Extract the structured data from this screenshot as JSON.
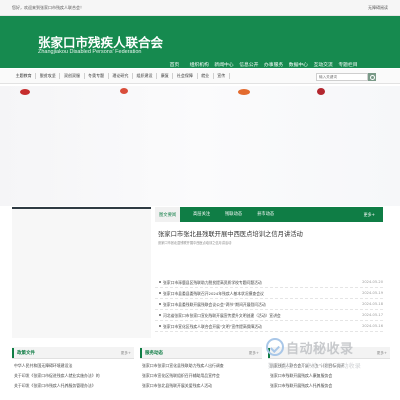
{
  "topbar": {
    "welcome": "您好，欢迎来到张家口市残疾人联合会！",
    "accessibility": "无障碍阅读"
  },
  "header": {
    "title_cn": "张家口市残疾人联合会",
    "title_en": "Zhangjiakou Disabled Persons' Federation",
    "nav": [
      "首页",
      "组织机构",
      "新闻中心",
      "信息公开",
      "办事服务",
      "数据中心",
      "互动交流",
      "专题栏目"
    ]
  },
  "subnav": {
    "items": [
      "主题教育",
      "脱贫攻坚",
      "双创双服",
      "冬奥专题",
      "理论研究",
      "组织建设",
      "康复",
      "社会保障",
      "就业",
      "宣传"
    ],
    "search_placeholder": "输入关键词"
  },
  "news": {
    "tabs": [
      "图文要闻",
      "高层关注",
      "残联动态",
      "县市动态"
    ],
    "more": "更多+",
    "headline": "张家口市张北县残联开展中西医点培训之信月讲活动",
    "summary": "张家口市张北县残联开展中西医点培训之信月讲活动",
    "items": [
      {
        "title": "张家口市涿鹿县区残联助力脱贫提高资质学校专题问题活动",
        "date": "2024-05-20"
      },
      {
        "title": "张家口市县委县委残联召开2024年残疾人基本状况摸查会议",
        "date": "2024-05-19"
      },
      {
        "title": "张家口市县委残联开展残联会议公会“两节”期间开展慰问活动",
        "date": "2024-05-18"
      },
      {
        "title": "河北省张家口市张家口宣化残联开展宣传提升文明创建（活动）宣讲会",
        "date": "2024-05-17"
      },
      {
        "title": "张家口市宣化区残疾人联合会开展“文明”宣传提高保障活动",
        "date": "2024-05-16"
      }
    ]
  },
  "sections": [
    {
      "title": "政策文件",
      "more": "更多+",
      "items": [
        "中华人民共和国无障碍环境建设法",
        "关于印发《张家口市促进残疾人就业实施办法》的",
        "关于印发《张家口市残疾人托养服务管理办法》"
      ]
    },
    {
      "title": "服务动态",
      "more": "更多+",
      "items": [
        "张家口市张家口宣化县残联助力残疾人出行调查",
        "张家口市宣化区残联组织召开辅助用品宣传会",
        "张家口市张北县残联开展关爱残疾人活动"
      ]
    },
    {
      "title": "",
      "more": "更多+",
      "items": [
        "国家残疾人联合会开展“八五”计划目标调研",
        "张家口市残联开展残疾人康复服务会",
        "张家口市残联开展残疾人托养服务会"
      ]
    }
  ],
  "watermark": {
    "brand": "自动秘收录",
    "slogan": "数上链接一一来访一次一自动收录"
  },
  "colors": {
    "brand_green": "#168a4f",
    "tab_green": "#0f7d45"
  }
}
